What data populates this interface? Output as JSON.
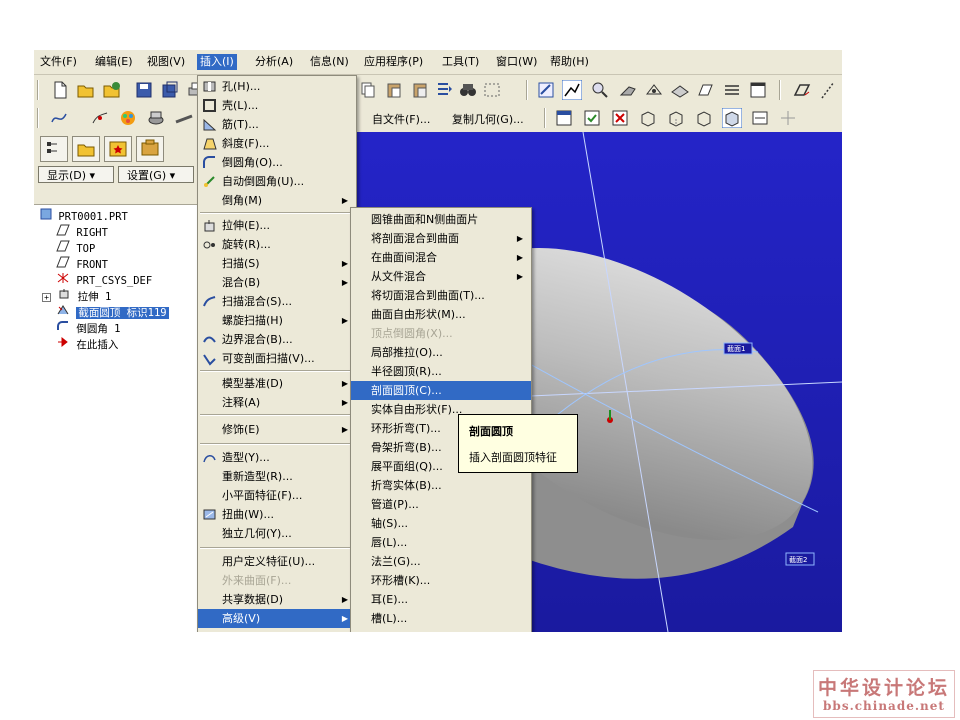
{
  "menubar": {
    "items": [
      {
        "label": "文件(F)"
      },
      {
        "label": "编辑(E)"
      },
      {
        "label": "视图(V)"
      },
      {
        "label": "插入(I)"
      },
      {
        "label": "分析(A)"
      },
      {
        "label": "信息(N)"
      },
      {
        "label": "应用程序(P)"
      },
      {
        "label": "工具(T)"
      },
      {
        "label": "窗口(W)"
      },
      {
        "label": "帮助(H)"
      }
    ]
  },
  "toolbar": {
    "file_label": "自文件(F)...",
    "copy_geom_label": "复制几何(G)..."
  },
  "left_panel": {
    "show_label": "显示(D) ▾",
    "settings_label": "设置(G) ▾"
  },
  "model_tree": {
    "items": [
      {
        "label": "PRT0001.PRT",
        "icon": "part-icon"
      },
      {
        "label": "RIGHT",
        "icon": "datum-plane-icon"
      },
      {
        "label": "TOP",
        "icon": "datum-plane-icon"
      },
      {
        "label": "FRONT",
        "icon": "datum-plane-icon"
      },
      {
        "label": "PRT_CSYS_DEF",
        "icon": "csys-icon"
      },
      {
        "label": "拉伸 1",
        "icon": "extrude-icon"
      },
      {
        "label": "截面圆顶 标识119",
        "icon": "dome-icon"
      },
      {
        "label": "倒圆角 1",
        "icon": "round-icon"
      },
      {
        "label": "在此插入",
        "icon": "insert-here-arrow-icon"
      }
    ]
  },
  "insert_menu": {
    "items": [
      {
        "label": "孔(H)...",
        "icon": "hole-icon"
      },
      {
        "label": "壳(L)...",
        "icon": "shell-icon"
      },
      {
        "label": "筋(T)...",
        "icon": "rib-icon"
      },
      {
        "label": "斜度(F)...",
        "icon": "draft-icon"
      },
      {
        "label": "倒圆角(O)...",
        "icon": "round-icon"
      },
      {
        "label": "自动倒圆角(U)...",
        "icon": "auto-round-icon"
      },
      {
        "label": "倒角(M)",
        "icon": "",
        "submenu": true
      },
      {
        "label": "拉伸(E)...",
        "icon": "extrude-icon"
      },
      {
        "label": "旋转(R)...",
        "icon": "revolve-icon"
      },
      {
        "label": "扫描(S)",
        "icon": "",
        "submenu": true
      },
      {
        "label": "混合(B)",
        "icon": "",
        "submenu": true
      },
      {
        "label": "扫描混合(S)...",
        "icon": "swept-blend-icon"
      },
      {
        "label": "螺旋扫描(H)",
        "icon": "",
        "submenu": true
      },
      {
        "label": "边界混合(B)...",
        "icon": "boundary-blend-icon"
      },
      {
        "label": "可变剖面扫描(V)...",
        "icon": "var-sweep-icon"
      },
      {
        "label": "模型基准(D)",
        "icon": "",
        "submenu": true
      },
      {
        "label": "注释(A)",
        "icon": "",
        "submenu": true
      },
      {
        "label": "修饰(E)",
        "icon": "",
        "submenu": true
      },
      {
        "label": "造型(Y)...",
        "icon": "style-icon"
      },
      {
        "label": "重新造型(R)...",
        "icon": ""
      },
      {
        "label": "小平面特征(F)...",
        "icon": ""
      },
      {
        "label": "扭曲(W)...",
        "icon": "warp-icon"
      },
      {
        "label": "独立几何(Y)...",
        "icon": ""
      },
      {
        "label": "用户定义特征(U)...",
        "icon": ""
      },
      {
        "label": "外来曲面(F)...",
        "icon": "",
        "disabled": true
      },
      {
        "label": "共享数据(D)",
        "icon": "",
        "submenu": true
      },
      {
        "label": "高级(V)",
        "icon": "",
        "submenu": true,
        "highlight": true
      }
    ]
  },
  "advanced_menu": {
    "items": [
      {
        "label": "圆锥曲面和N侧曲面片"
      },
      {
        "label": "将剖面混合到曲面",
        "submenu": true
      },
      {
        "label": "在曲面间混合",
        "submenu": true
      },
      {
        "label": "从文件混合",
        "submenu": true
      },
      {
        "label": "将切面混合到曲面(T)..."
      },
      {
        "label": "曲面自由形状(M)..."
      },
      {
        "label": "顶点倒圆角(X)...",
        "disabled": true
      },
      {
        "label": "局部推拉(O)..."
      },
      {
        "label": "半径圆顶(R)..."
      },
      {
        "label": "剖面圆顶(C)...",
        "highlight": true
      },
      {
        "label": "实体自由形状(F)..."
      },
      {
        "label": "环形折弯(T)..."
      },
      {
        "label": "骨架折弯(B)..."
      },
      {
        "label": "展平面组(Q)..."
      },
      {
        "label": "折弯实体(B)..."
      },
      {
        "label": "管道(P)..."
      },
      {
        "label": "轴(S)..."
      },
      {
        "label": "唇(L)..."
      },
      {
        "label": "法兰(G)..."
      },
      {
        "label": "环形槽(K)..."
      },
      {
        "label": "耳(E)..."
      },
      {
        "label": "槽(L)..."
      }
    ]
  },
  "tooltip": {
    "title": "剖面圆顶",
    "body": "插入剖面圆顶特征"
  },
  "viewport": {
    "label_top": "截面1",
    "label_bottom": "截面2"
  },
  "watermark": {
    "line1": "中华设计论坛",
    "line2": "bbs.chinade.net"
  },
  "colors": {
    "highlight": "#316ac5",
    "viewport": "#2424c8",
    "tooltip_bg": "#ffffe1",
    "watermark": "#c87878"
  }
}
